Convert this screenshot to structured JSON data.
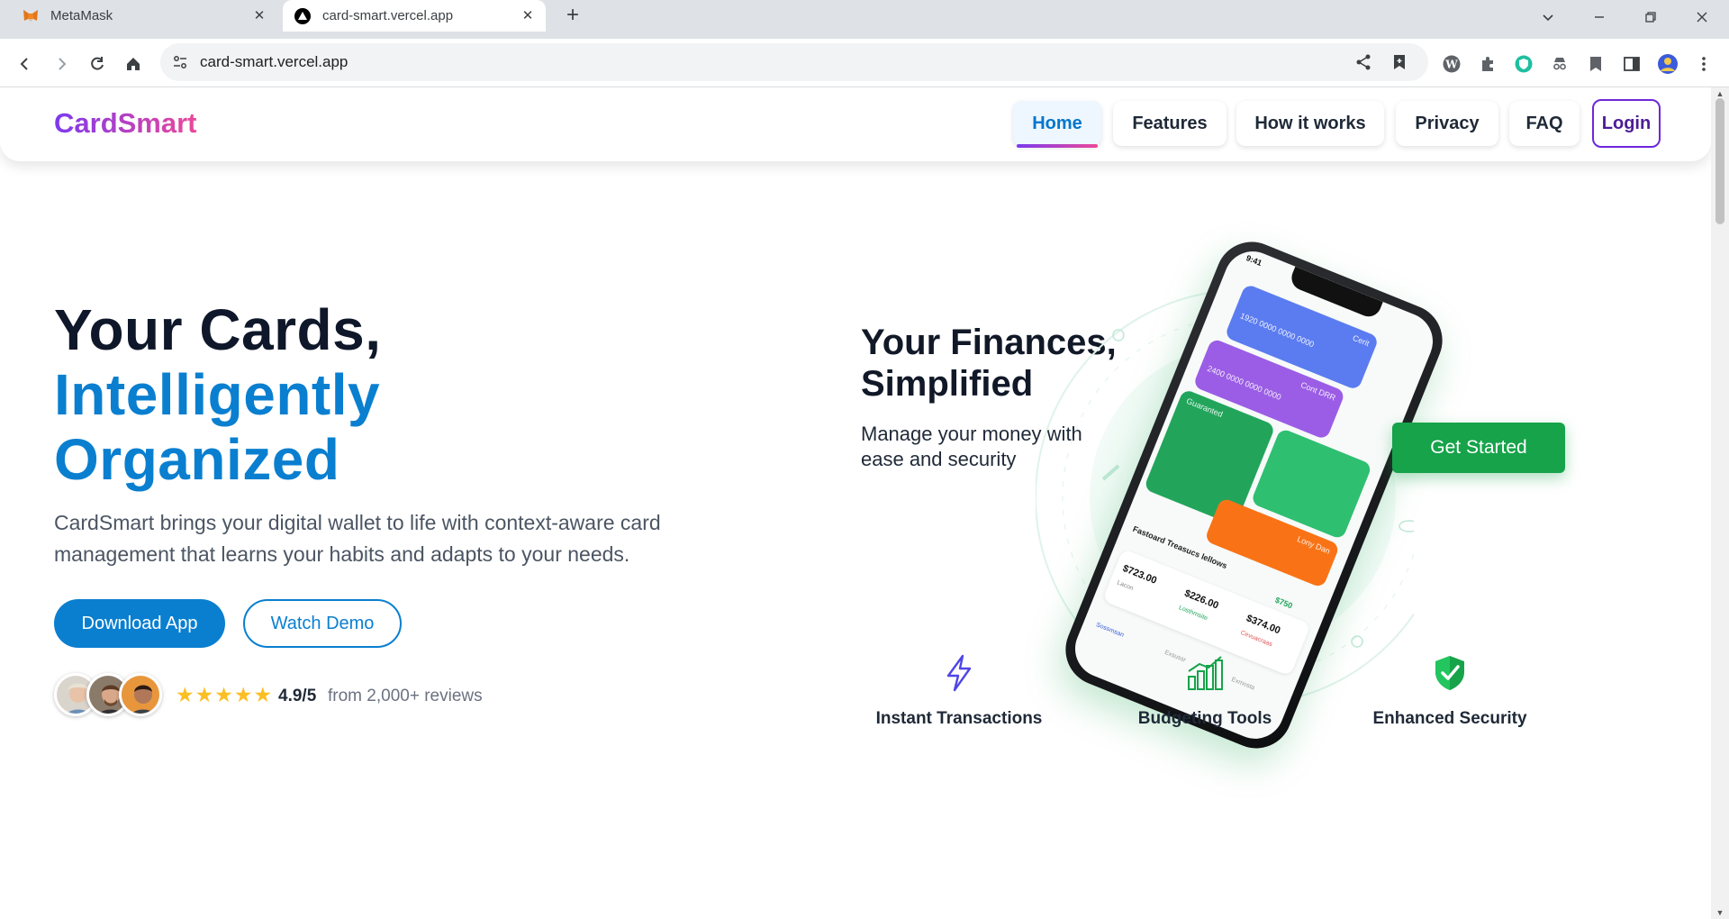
{
  "browser": {
    "tabs": [
      {
        "title": "MetaMask",
        "active": false
      },
      {
        "title": "card-smart.vercel.app",
        "active": true
      }
    ],
    "url": "card-smart.vercel.app"
  },
  "site": {
    "logo": "CardSmart",
    "nav": [
      {
        "label": "Home",
        "active": true
      },
      {
        "label": "Features",
        "active": false
      },
      {
        "label": "How it works",
        "active": false
      },
      {
        "label": "Privacy",
        "active": false
      },
      {
        "label": "FAQ",
        "active": false
      },
      {
        "label": "Login",
        "active": false
      }
    ]
  },
  "hero": {
    "headline_line1": "Your Cards,",
    "headline_line2": "Intelligently",
    "headline_line3": "Organized",
    "lead": "CardSmart brings your digital wallet to life with context-aware card management that learns your habits and adapts to your needs.",
    "primary_button": "Download App",
    "secondary_button": "Watch Demo",
    "stars": "★★★★★",
    "rating": "4.9/5",
    "reviews": "from 2,000+ reviews"
  },
  "showcase": {
    "title_line1": "Your Finances,",
    "title_line2": "Simplified",
    "subtitle": "Manage your money with ease and security",
    "cta": "Get Started",
    "phone": {
      "time": "9:41",
      "cards": [
        {
          "label": "Cerit",
          "number": "1920 0000 0000 0000",
          "color": "#5b7cf0"
        },
        {
          "label": "Cont DRR",
          "number": "2400 0000 0000 0000",
          "color": "#9b5de5"
        },
        {
          "label": "Guaranted",
          "number": "",
          "color": "#22a55b"
        },
        {
          "label": "Lony Dan",
          "number": "",
          "color": "#f97316"
        }
      ],
      "section_title": "Fastoard Treasucs lellows",
      "amounts": [
        "$723.00",
        "$226.00",
        "$374.00"
      ],
      "amount_notes": [
        "Lacon",
        "Losthmsite",
        "Cevuacraas"
      ],
      "highlight": "$750",
      "tabs": [
        "Sossmsan",
        "Exsussr",
        "Exmosta"
      ]
    }
  },
  "features": [
    {
      "label": "Instant Transactions",
      "icon": "lightning-icon"
    },
    {
      "label": "Budgeting Tools",
      "icon": "bar-chart-icon"
    },
    {
      "label": "Enhanced Security",
      "icon": "shield-icon"
    }
  ],
  "colors": {
    "brand_blue": "#0a7fd0",
    "brand_purple": "#7c3aed",
    "brand_pink": "#ec4899",
    "cta_green": "#16a34a"
  }
}
